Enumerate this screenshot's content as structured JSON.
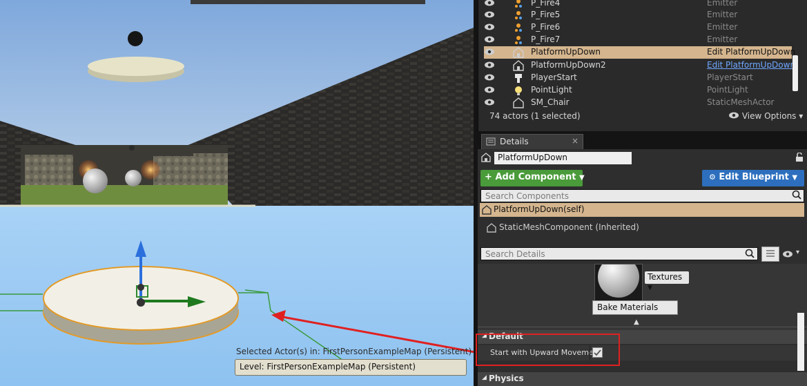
{
  "viewport": {
    "selected_actors_text": "Selected Actor(s) in:  FirstPersonExampleMap (Persistent)",
    "level_label": "Level:  FirstPersonExampleMap (Persistent)"
  },
  "outliner": {
    "rows": [
      {
        "name": "P_Fire4",
        "type": "Emitter",
        "icon": "emitter-icon"
      },
      {
        "name": "P_Fire5",
        "type": "Emitter",
        "icon": "emitter-icon"
      },
      {
        "name": "P_Fire6",
        "type": "Emitter",
        "icon": "emitter-icon"
      },
      {
        "name": "P_Fire7",
        "type": "Emitter",
        "icon": "emitter-icon"
      },
      {
        "name": "PlatformUpDown",
        "type": "Edit PlatformUpDown",
        "icon": "blueprint-actor-icon"
      },
      {
        "name": "PlatformUpDown2",
        "type": "Edit PlatformUpDowr",
        "icon": "blueprint-actor-icon"
      },
      {
        "name": "PlayerStart",
        "type": "PlayerStart",
        "icon": "player-start-icon"
      },
      {
        "name": "PointLight",
        "type": "PointLight",
        "icon": "point-light-icon"
      },
      {
        "name": "SM_Chair",
        "type": "StaticMeshActor",
        "icon": "static-mesh-icon"
      }
    ],
    "actor_count": "74 actors (1 selected)",
    "view_options": "View Options"
  },
  "details": {
    "tab_label": "Details",
    "actor_name": "PlatformUpDown",
    "add_component": "Add Component",
    "edit_blueprint": "Edit Blueprint",
    "search_components_placeholder": "Search Components",
    "self_component": "PlatformUpDown(self)",
    "inherited_component": "StaticMeshComponent (Inherited)",
    "search_details_placeholder": "Search Details",
    "textures_label": "Textures",
    "bake_materials": "Bake Materials",
    "section_default": "Default",
    "property_label": "Start with Upward Movement",
    "property_checked": true,
    "section_physics": "Physics"
  },
  "colors": {
    "selection": "#d4b58e",
    "add_component_green": "#4a9b3a",
    "edit_blueprint_blue": "#2d6fbe",
    "annotation_red": "#e02020"
  }
}
